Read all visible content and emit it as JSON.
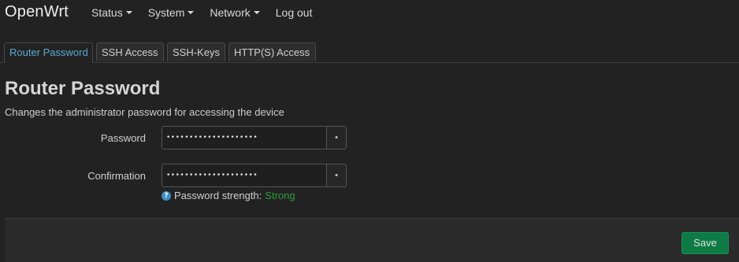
{
  "header": {
    "brand": "OpenWrt",
    "menu": [
      {
        "label": "Status",
        "dropdown": true
      },
      {
        "label": "System",
        "dropdown": true
      },
      {
        "label": "Network",
        "dropdown": true
      },
      {
        "label": "Log out",
        "dropdown": false
      }
    ]
  },
  "tabs": [
    {
      "label": "Router Password",
      "active": true
    },
    {
      "label": "SSH Access",
      "active": false
    },
    {
      "label": "SSH-Keys",
      "active": false
    },
    {
      "label": "HTTP(S) Access",
      "active": false
    }
  ],
  "page": {
    "title": "Router Password",
    "description": "Changes the administrator password for accessing the device"
  },
  "form": {
    "password": {
      "label": "Password",
      "value": "••••••••••••••••••••",
      "reveal_glyph": "•"
    },
    "confirmation": {
      "label": "Confirmation",
      "value": "••••••••••••••••••••",
      "reveal_glyph": "•"
    },
    "strength": {
      "icon": "?",
      "label": "Password strength:",
      "value": "Strong"
    }
  },
  "footer": {
    "save_label": "Save"
  },
  "colors": {
    "accent": "#5ba9d3",
    "strong": "#2c9e3a",
    "save": "#0e7a45"
  }
}
